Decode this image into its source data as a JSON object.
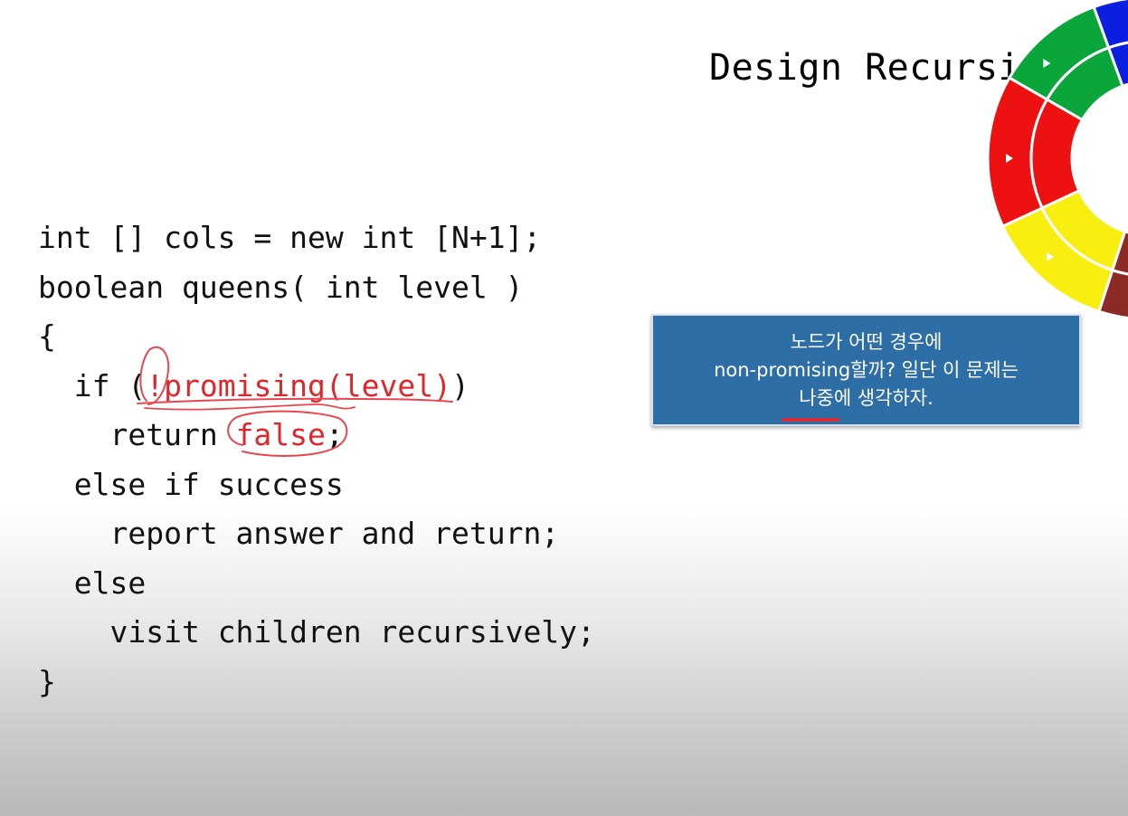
{
  "slide": {
    "title": "Design Recursi"
  },
  "code": {
    "lines": [
      {
        "indent": "",
        "pre": "int [] cols = new int [N+1];",
        "red": "",
        "post": ""
      },
      {
        "indent": "",
        "pre": "boolean queens( int level )",
        "red": "",
        "post": ""
      },
      {
        "indent": "",
        "pre": "{",
        "red": "",
        "post": ""
      },
      {
        "indent": "  ",
        "pre": "if (",
        "red": "!promising(level)",
        "post": ")"
      },
      {
        "indent": "    ",
        "pre": "return ",
        "red": "false",
        "post": ";"
      },
      {
        "indent": "  ",
        "pre": "else if success",
        "red": "",
        "post": ""
      },
      {
        "indent": "    ",
        "pre": "report answer and return;",
        "red": "",
        "post": ""
      },
      {
        "indent": "  ",
        "pre": "else",
        "red": "",
        "post": ""
      },
      {
        "indent": "    ",
        "pre": "visit children recursively;",
        "red": "",
        "post": ""
      },
      {
        "indent": "",
        "pre": "}",
        "red": "",
        "post": ""
      }
    ]
  },
  "note": {
    "lines": [
      "노드가 어떤 경우에",
      "non-promising할까? 일단 이 문제는",
      "나중에 생각하자."
    ]
  },
  "colors": {
    "code_highlight": "#e0262a",
    "annotation_ink": "#e8474f",
    "note_background": "#2c6ea5",
    "wheel_blue": "#0a1fe0",
    "wheel_green": "#0aa63c",
    "wheel_red": "#ee1111",
    "wheel_yellow": "#f8ef10",
    "wheel_maroon": "#8c2a26"
  }
}
